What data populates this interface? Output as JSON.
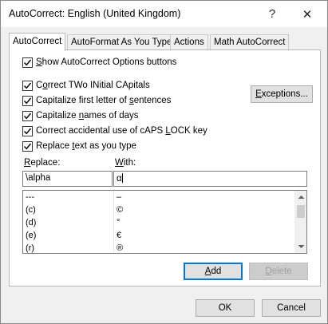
{
  "window": {
    "title": "AutoCorrect: English (United Kingdom)",
    "help_glyph": "?",
    "close_glyph": "✕"
  },
  "tabs": [
    {
      "label": "AutoCorrect",
      "active": true
    },
    {
      "label": "AutoFormat As You Type",
      "active": false
    },
    {
      "label": "Actions",
      "active": false
    },
    {
      "label": "Math AutoCorrect",
      "active": false
    }
  ],
  "options": {
    "show_buttons": {
      "pre": "",
      "mn": "S",
      "post": "how AutoCorrect Options buttons",
      "checked": true
    },
    "two_initial": {
      "pre": "C",
      "mn": "o",
      "post": "rrect TWo INitial CApitals",
      "checked": true
    },
    "first_letter": {
      "pre": "Capitalize first letter of ",
      "mn": "s",
      "post": "entences",
      "checked": true
    },
    "days": {
      "pre": "Capitalize ",
      "mn": "n",
      "post": "ames of days",
      "checked": true
    },
    "caps_lock": {
      "pre": "Correct accidental use of cAPS ",
      "mn": "L",
      "post": "OCK key",
      "checked": true
    },
    "replace_text": {
      "pre": "Replace ",
      "mn": "t",
      "post": "ext as you type",
      "checked": true
    }
  },
  "exceptions_button": {
    "pre": "",
    "mn": "E",
    "post": "xceptions..."
  },
  "replace": {
    "label_pre": "",
    "label_mn": "R",
    "label_post": "eplace:",
    "value": "\\alpha"
  },
  "with": {
    "label_pre": "",
    "label_mn": "W",
    "label_post": "ith:",
    "value": "α"
  },
  "table": {
    "rows": [
      {
        "replace": "---",
        "with": "–"
      },
      {
        "replace": "(c)",
        "with": "©"
      },
      {
        "replace": "(d)",
        "with": "°"
      },
      {
        "replace": "(e)",
        "with": "€"
      },
      {
        "replace": "(r)",
        "with": "®"
      }
    ]
  },
  "actions": {
    "add": {
      "pre": "",
      "mn": "A",
      "post": "dd"
    },
    "delete": {
      "pre": "",
      "mn": "D",
      "post": "elete"
    }
  },
  "footer": {
    "ok": "OK",
    "cancel": "Cancel"
  }
}
